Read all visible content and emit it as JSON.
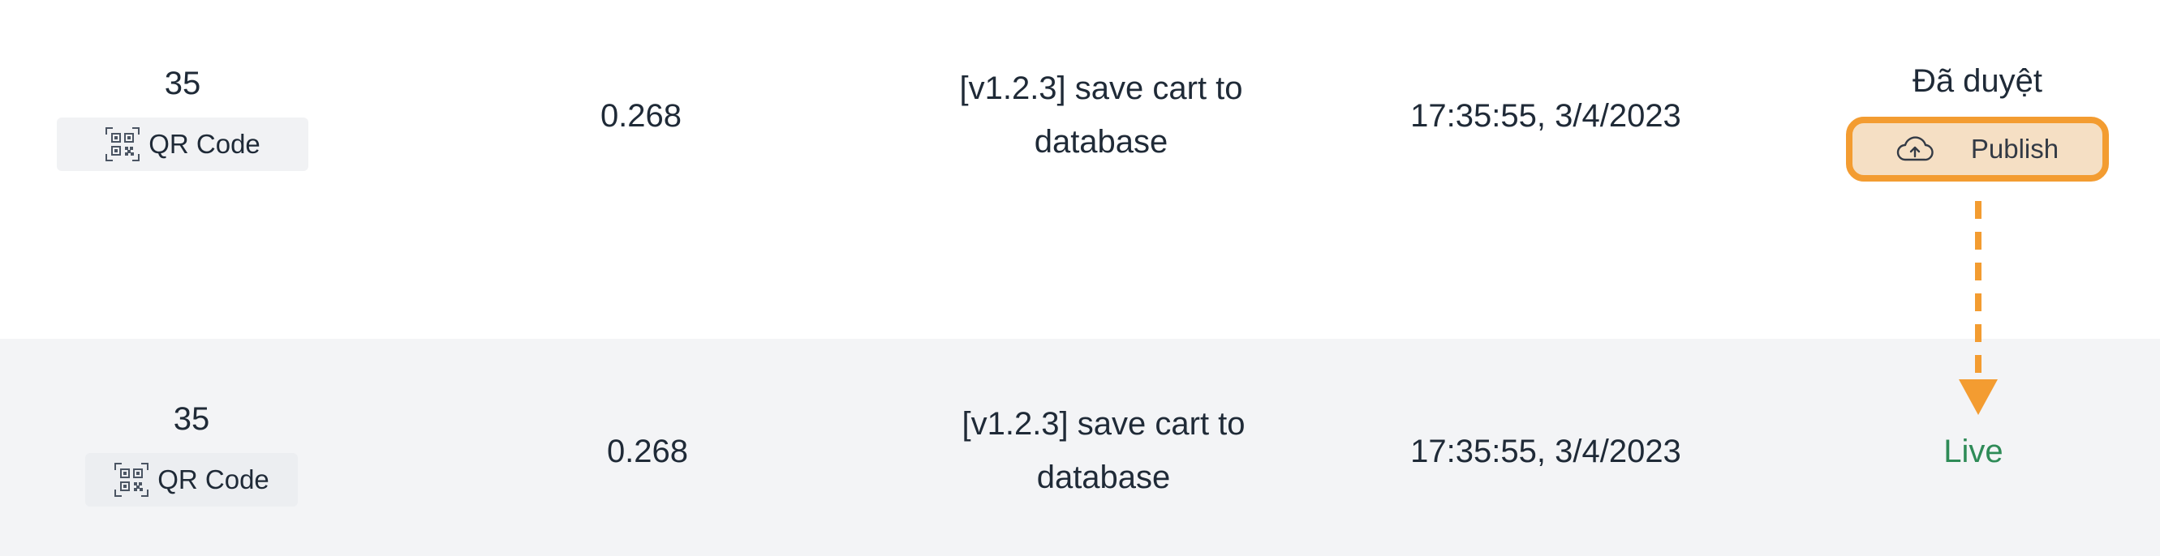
{
  "rows": [
    {
      "id": "35",
      "qr_label": "QR Code",
      "version": "0.268",
      "description": "[v1.2.3] save cart to database",
      "timestamp": "17:35:55, 3/4/2023",
      "status": "Đã duyệt",
      "action_label": "Publish"
    },
    {
      "id": "35",
      "qr_label": "QR Code",
      "version": "0.268",
      "description": "[v1.2.3] save cart to database",
      "timestamp": "17:35:55, 3/4/2023",
      "status": "Live"
    }
  ],
  "icons": {
    "qr": "qr-code-icon",
    "publish": "cloud-upload-icon",
    "annotation": "dashed-arrow-down"
  },
  "colors": {
    "highlight": "#f39c31",
    "publish_fill": "#f5dfc4",
    "live": "#2e8b57",
    "row_alt_bg": "#f3f4f6"
  }
}
